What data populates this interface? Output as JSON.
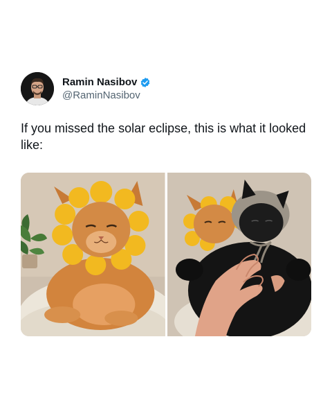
{
  "author": {
    "name": "Ramin Nasibov",
    "handle": "@RaminNasibov",
    "verified_icon": "verified-badge-icon",
    "verified_color": "#1d9bf0"
  },
  "tweet": {
    "text": "If you missed the solar eclipse, this is what it looked like:"
  },
  "media": {
    "photos": [
      {
        "description_icon": "orange-cat-sunflower-hat-photo"
      },
      {
        "description_icon": "black-cat-knit-bonnet-photo"
      }
    ]
  }
}
